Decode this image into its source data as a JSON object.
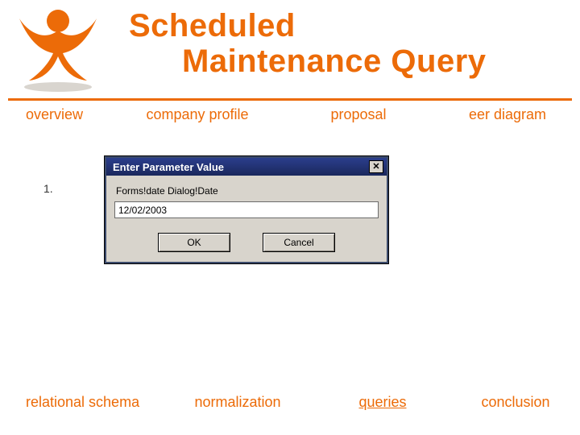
{
  "title": {
    "line1": "Scheduled",
    "line2": "Maintenance Query"
  },
  "nav_top": {
    "items": [
      {
        "label": "overview",
        "active": false
      },
      {
        "label": "company profile",
        "active": false
      },
      {
        "label": "proposal",
        "active": false
      },
      {
        "label": "eer diagram",
        "active": false
      }
    ]
  },
  "nav_bottom": {
    "items": [
      {
        "label": "relational schema",
        "active": false
      },
      {
        "label": "normalization",
        "active": false
      },
      {
        "label": "queries",
        "active": true
      },
      {
        "label": "conclusion",
        "active": false
      }
    ]
  },
  "list_number": "1.",
  "dialog": {
    "title": "Enter Parameter Value",
    "close_glyph": "✕",
    "prompt": "Forms!date Dialog!Date",
    "input_value": "12/02/2003",
    "ok_label": "OK",
    "cancel_label": "Cancel"
  },
  "colors": {
    "accent": "#ec6b08"
  }
}
